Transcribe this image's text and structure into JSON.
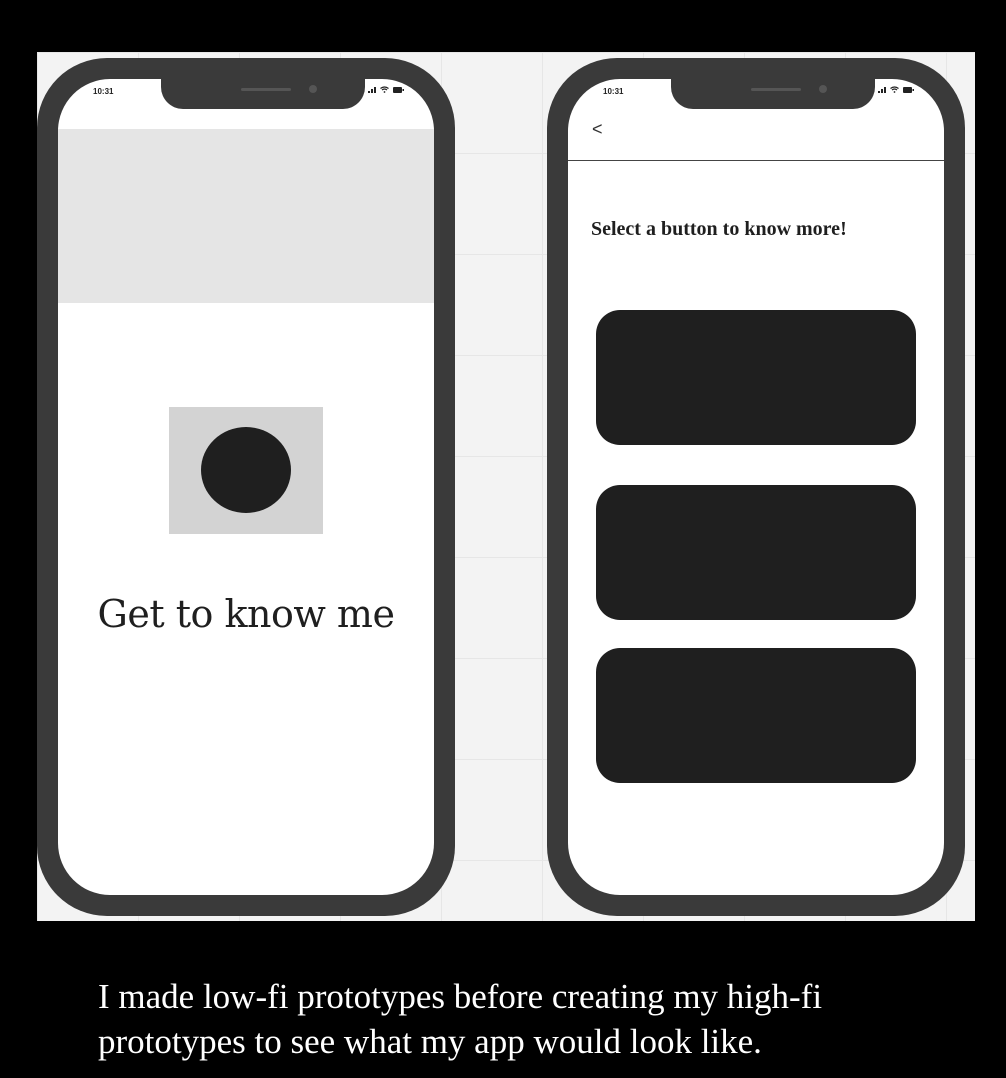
{
  "left_phone": {
    "status_time": "10:31",
    "title": "Get to know me"
  },
  "right_phone": {
    "status_time": "10:31",
    "back_label": "<",
    "prompt": "Select a button to know more!",
    "option_buttons": [
      {
        "label": ""
      },
      {
        "label": ""
      },
      {
        "label": ""
      }
    ]
  },
  "caption": {
    "line1": "I made low-fi prototypes before creating my high-fi",
    "line2": "prototypes to see what my app would look like."
  },
  "colors": {
    "background": "#000000",
    "board": "#f3f3f3",
    "phone_frame": "#3a3a3a",
    "placeholder_dark": "#1f1f1f",
    "placeholder_light": "#e5e5e5",
    "caption_text": "#ffffff"
  },
  "icons": [
    "signal-icon",
    "wifi-icon",
    "battery-icon",
    "back-chevron-icon"
  ]
}
